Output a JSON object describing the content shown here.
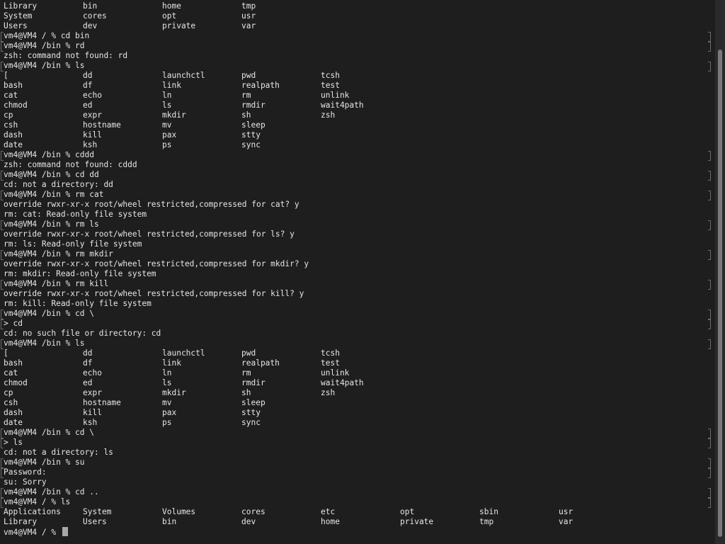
{
  "terminal": {
    "lines": [
      {
        "type": "cols",
        "cells": [
          "Library",
          "bin",
          "home",
          "tmp"
        ]
      },
      {
        "type": "cols",
        "cells": [
          "System",
          "cores",
          "opt",
          "usr"
        ]
      },
      {
        "type": "cols",
        "cells": [
          "Users",
          "dev",
          "private",
          "var"
        ]
      },
      {
        "type": "prompt",
        "text": "vm4@VM4 / % cd bin"
      },
      {
        "type": "prompt",
        "text": "vm4@VM4 /bin % rd"
      },
      {
        "type": "text",
        "text": "zsh: command not found: rd"
      },
      {
        "type": "prompt",
        "text": "vm4@VM4 /bin % ls"
      },
      {
        "type": "cols",
        "cells": [
          "[",
          "dd",
          "launchctl",
          "pwd",
          "tcsh"
        ]
      },
      {
        "type": "cols",
        "cells": [
          "bash",
          "df",
          "link",
          "realpath",
          "test"
        ]
      },
      {
        "type": "cols",
        "cells": [
          "cat",
          "echo",
          "ln",
          "rm",
          "unlink"
        ]
      },
      {
        "type": "cols",
        "cells": [
          "chmod",
          "ed",
          "ls",
          "rmdir",
          "wait4path"
        ]
      },
      {
        "type": "cols",
        "cells": [
          "cp",
          "expr",
          "mkdir",
          "sh",
          "zsh"
        ]
      },
      {
        "type": "cols",
        "cells": [
          "csh",
          "hostname",
          "mv",
          "sleep"
        ]
      },
      {
        "type": "cols",
        "cells": [
          "dash",
          "kill",
          "pax",
          "stty"
        ]
      },
      {
        "type": "cols",
        "cells": [
          "date",
          "ksh",
          "ps",
          "sync"
        ]
      },
      {
        "type": "prompt",
        "text": "vm4@VM4 /bin % cddd"
      },
      {
        "type": "text",
        "text": "zsh: command not found: cddd"
      },
      {
        "type": "prompt",
        "text": "vm4@VM4 /bin % cd dd"
      },
      {
        "type": "text",
        "text": "cd: not a directory: dd"
      },
      {
        "type": "prompt",
        "text": "vm4@VM4 /bin % rm cat"
      },
      {
        "type": "text",
        "text": "override rwxr-xr-x root/wheel restricted,compressed for cat? y"
      },
      {
        "type": "text",
        "text": "rm: cat: Read-only file system"
      },
      {
        "type": "prompt",
        "text": "vm4@VM4 /bin % rm ls"
      },
      {
        "type": "text",
        "text": "override rwxr-xr-x root/wheel restricted,compressed for ls? y"
      },
      {
        "type": "text",
        "text": "rm: ls: Read-only file system"
      },
      {
        "type": "prompt",
        "text": "vm4@VM4 /bin % rm mkdir"
      },
      {
        "type": "text",
        "text": "override rwxr-xr-x root/wheel restricted,compressed for mkdir? y"
      },
      {
        "type": "text",
        "text": "rm: mkdir: Read-only file system"
      },
      {
        "type": "prompt",
        "text": "vm4@VM4 /bin % rm kill"
      },
      {
        "type": "text",
        "text": "override rwxr-xr-x root/wheel restricted,compressed for kill? y"
      },
      {
        "type": "text",
        "text": "rm: kill: Read-only file system"
      },
      {
        "type": "prompt",
        "text": "vm4@VM4 /bin % cd \\"
      },
      {
        "type": "prompt",
        "text": "> cd"
      },
      {
        "type": "text",
        "text": "cd: no such file or directory: cd"
      },
      {
        "type": "prompt",
        "text": "vm4@VM4 /bin % ls"
      },
      {
        "type": "cols",
        "cells": [
          "[",
          "dd",
          "launchctl",
          "pwd",
          "tcsh"
        ]
      },
      {
        "type": "cols",
        "cells": [
          "bash",
          "df",
          "link",
          "realpath",
          "test"
        ]
      },
      {
        "type": "cols",
        "cells": [
          "cat",
          "echo",
          "ln",
          "rm",
          "unlink"
        ]
      },
      {
        "type": "cols",
        "cells": [
          "chmod",
          "ed",
          "ls",
          "rmdir",
          "wait4path"
        ]
      },
      {
        "type": "cols",
        "cells": [
          "cp",
          "expr",
          "mkdir",
          "sh",
          "zsh"
        ]
      },
      {
        "type": "cols",
        "cells": [
          "csh",
          "hostname",
          "mv",
          "sleep"
        ]
      },
      {
        "type": "cols",
        "cells": [
          "dash",
          "kill",
          "pax",
          "stty"
        ]
      },
      {
        "type": "cols",
        "cells": [
          "date",
          "ksh",
          "ps",
          "sync"
        ]
      },
      {
        "type": "prompt",
        "text": "vm4@VM4 /bin % cd \\"
      },
      {
        "type": "prompt",
        "text": "> ls"
      },
      {
        "type": "text",
        "text": "cd: not a directory: ls"
      },
      {
        "type": "prompt",
        "text": "vm4@VM4 /bin % su"
      },
      {
        "type": "prompt",
        "text": "Password:"
      },
      {
        "type": "text",
        "text": "su: Sorry"
      },
      {
        "type": "prompt",
        "text": "vm4@VM4 /bin % cd .."
      },
      {
        "type": "prompt",
        "text": "vm4@VM4 / % ls"
      },
      {
        "type": "cols",
        "cells": [
          "Applications",
          "System",
          "Volumes",
          "cores",
          "etc",
          "opt",
          "sbin",
          "usr"
        ]
      },
      {
        "type": "cols",
        "cells": [
          "Library",
          "Users",
          "bin",
          "dev",
          "home",
          "private",
          "tmp",
          "var"
        ]
      },
      {
        "type": "current",
        "text": "vm4@VM4 / % "
      }
    ]
  }
}
